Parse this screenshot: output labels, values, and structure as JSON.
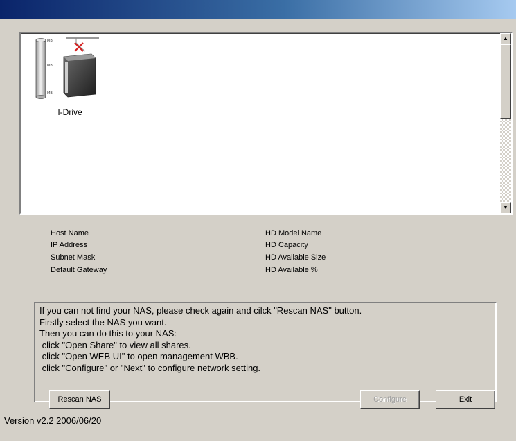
{
  "titlebar": {
    "title": ""
  },
  "nas_list": {
    "items": [
      {
        "label": "I-Drive",
        "icon": "nas-drive-disconnected-icon"
      }
    ]
  },
  "info": {
    "left": [
      "Host Name",
      "IP Address",
      "Subnet Mask",
      "Default Gateway"
    ],
    "right": [
      "HD Model Name",
      "HD Capacity",
      "HD Available Size",
      "HD Available %"
    ]
  },
  "messages": [
    "If you can not find your NAS, please check again and cilck \"Rescan NAS\" button.",
    "Firstly select the NAS you want.",
    "Then you can do this to your NAS:",
    " click \"Open Share\" to view all shares.",
    " click \"Open WEB UI\" to open management WBB.",
    " click \"Configure\" or \"Next\" to configure network setting."
  ],
  "buttons": {
    "rescan": "Rescan NAS",
    "configure": "Configure",
    "exit": "Exit"
  },
  "version": "Version v2.2 2006/06/20",
  "colors": {
    "titlebar_start": "#0a246a",
    "titlebar_end": "#a6caf0",
    "face": "#d4d0c8"
  }
}
